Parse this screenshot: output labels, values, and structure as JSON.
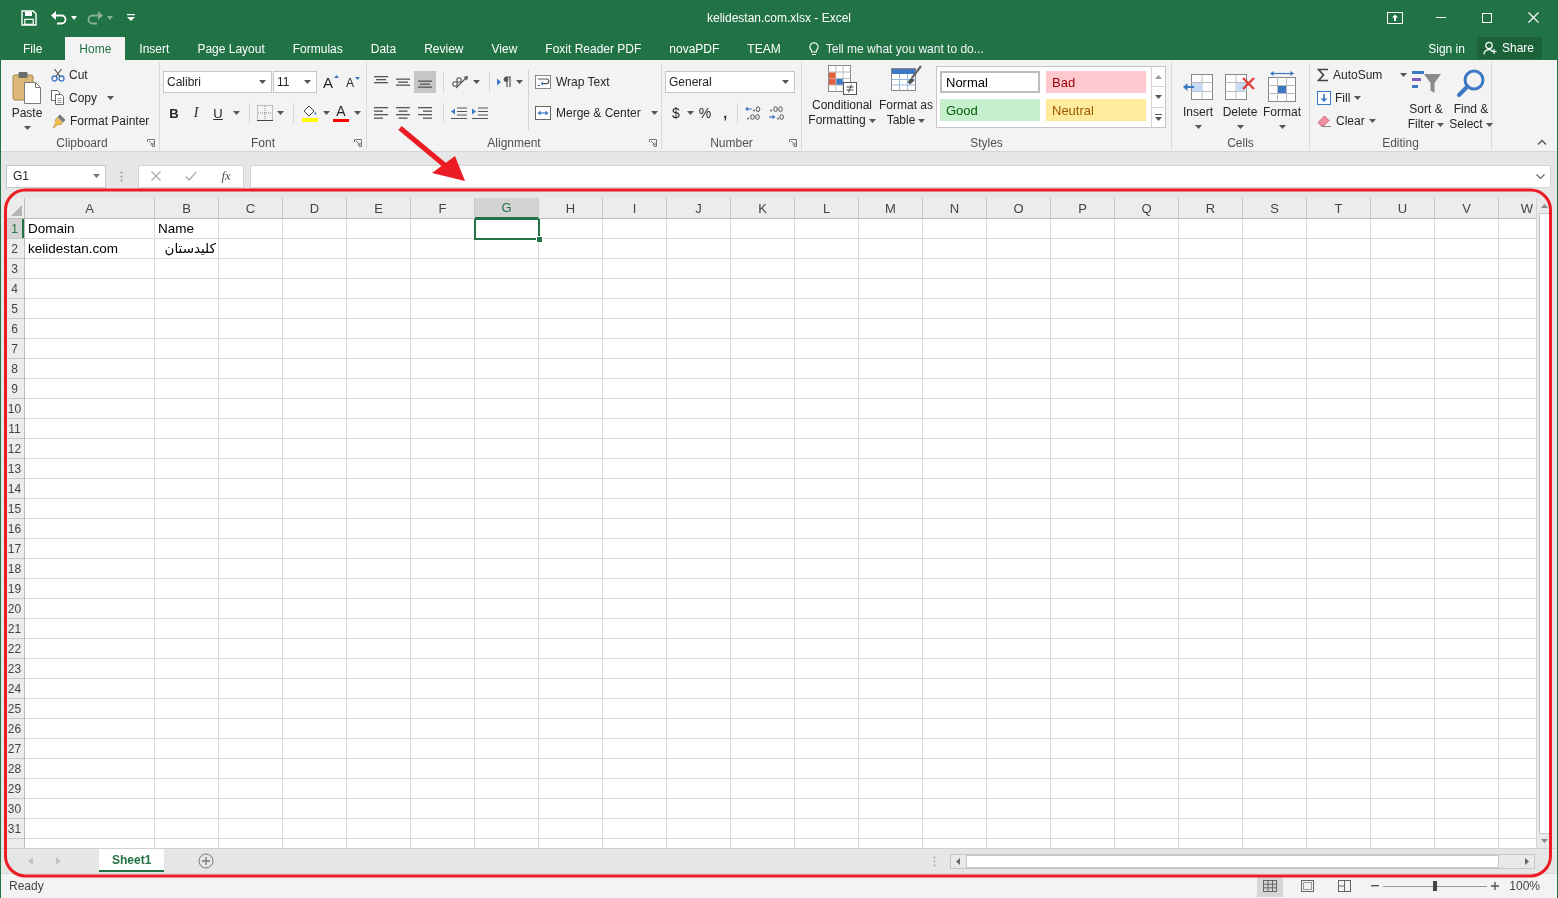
{
  "window": {
    "title": "kelidestan.com.xlsx - Excel"
  },
  "quick_access": [
    {
      "kind": "save",
      "disabled": false
    },
    {
      "kind": "undo",
      "disabled": false
    },
    {
      "kind": "redo",
      "disabled": true
    }
  ],
  "tabs": [
    {
      "label": "File",
      "selected": false
    },
    {
      "label": "Home",
      "selected": true
    },
    {
      "label": "Insert",
      "selected": false
    },
    {
      "label": "Page Layout",
      "selected": false
    },
    {
      "label": "Formulas",
      "selected": false
    },
    {
      "label": "Data",
      "selected": false
    },
    {
      "label": "Review",
      "selected": false
    },
    {
      "label": "View",
      "selected": false
    },
    {
      "label": "Foxit Reader PDF",
      "selected": false
    },
    {
      "label": "novaPDF",
      "selected": false
    },
    {
      "label": "TEAM",
      "selected": false
    }
  ],
  "tell_me": {
    "placeholder": "Tell me what you want to do..."
  },
  "account": {
    "sign_in": "Sign in",
    "share": "Share"
  },
  "ribbon": {
    "clipboard": {
      "label": "Clipboard",
      "paste": "Paste",
      "cut": "Cut",
      "copy": "Copy",
      "format_painter": "Format Painter"
    },
    "font": {
      "label": "Font",
      "font_name": "Calibri",
      "font_size": "11",
      "grow": "A",
      "shrink": "A",
      "bold": "B",
      "italic": "I",
      "underline": "U",
      "font_color": "A"
    },
    "alignment": {
      "label": "Alignment",
      "vertical_align": [
        {
          "kind": "top",
          "selected": false
        },
        {
          "kind": "middle",
          "selected": false
        },
        {
          "kind": "bottom",
          "selected": true
        }
      ],
      "horizontal_align": [
        {
          "kind": "left",
          "selected": false
        },
        {
          "kind": "center",
          "selected": false
        },
        {
          "kind": "right",
          "selected": false
        }
      ],
      "wrap_text": "Wrap Text",
      "merge_center": "Merge & Center"
    },
    "number": {
      "label": "Number",
      "format": "General",
      "currency": "$",
      "percent": "%",
      "comma": ","
    },
    "styles": {
      "label": "Styles",
      "conditional_formatting": "Conditional Formatting",
      "format_as_table": "Format as Table",
      "cell_styles": [
        {
          "label": "Normal",
          "kind": "normal",
          "selected": true
        },
        {
          "label": "Bad",
          "kind": "bad",
          "selected": false
        },
        {
          "label": "Good",
          "kind": "good",
          "selected": false
        },
        {
          "label": "Neutral",
          "kind": "neutral",
          "selected": false
        }
      ]
    },
    "cells": {
      "label": "Cells",
      "buttons": [
        {
          "label": "Insert",
          "kind": "insert"
        },
        {
          "label": "Delete",
          "kind": "delete"
        },
        {
          "label": "Format",
          "kind": "format"
        }
      ]
    },
    "editing": {
      "label": "Editing",
      "autosum": "AutoSum",
      "fill": "Fill",
      "clear": "Clear",
      "sort_filter": "Sort & Filter",
      "find_select": "Find & Select"
    }
  },
  "formula_bar": {
    "name_box": "G1",
    "function": "fx"
  },
  "sheet": {
    "columns": [
      {
        "label": "A",
        "selected": false
      },
      {
        "label": "B",
        "selected": false
      },
      {
        "label": "C",
        "selected": false
      },
      {
        "label": "D",
        "selected": false
      },
      {
        "label": "E",
        "selected": false
      },
      {
        "label": "F",
        "selected": false
      },
      {
        "label": "G",
        "selected": true
      },
      {
        "label": "H",
        "selected": false
      },
      {
        "label": "I",
        "selected": false
      },
      {
        "label": "J",
        "selected": false
      },
      {
        "label": "K",
        "selected": false
      },
      {
        "label": "L",
        "selected": false
      },
      {
        "label": "M",
        "selected": false
      },
      {
        "label": "N",
        "selected": false
      },
      {
        "label": "O",
        "selected": false
      },
      {
        "label": "P",
        "selected": false
      },
      {
        "label": "Q",
        "selected": false
      },
      {
        "label": "R",
        "selected": false
      },
      {
        "label": "S",
        "selected": false
      },
      {
        "label": "T",
        "selected": false
      },
      {
        "label": "U",
        "selected": false
      },
      {
        "label": "V",
        "selected": false
      },
      {
        "label": "W",
        "selected": false
      }
    ],
    "rows": [
      {
        "label": "1",
        "selected": true,
        "cells": [
          "Domain",
          "Name"
        ]
      },
      {
        "label": "2",
        "selected": false,
        "cells": [
          "kelidestan.com",
          "کلیدستان"
        ]
      },
      {
        "label": "3",
        "selected": false
      },
      {
        "label": "4",
        "selected": false
      },
      {
        "label": "5",
        "selected": false
      },
      {
        "label": "6",
        "selected": false
      },
      {
        "label": "7",
        "selected": false
      },
      {
        "label": "8",
        "selected": false
      },
      {
        "label": "9",
        "selected": false
      },
      {
        "label": "10",
        "selected": false
      },
      {
        "label": "11",
        "selected": false
      },
      {
        "label": "12",
        "selected": false
      },
      {
        "label": "13",
        "selected": false
      },
      {
        "label": "14",
        "selected": false
      },
      {
        "label": "15",
        "selected": false
      },
      {
        "label": "16",
        "selected": false
      },
      {
        "label": "17",
        "selected": false
      },
      {
        "label": "18",
        "selected": false
      },
      {
        "label": "19",
        "selected": false
      },
      {
        "label": "20",
        "selected": false
      },
      {
        "label": "21",
        "selected": false
      },
      {
        "label": "22",
        "selected": false
      },
      {
        "label": "23",
        "selected": false
      },
      {
        "label": "24",
        "selected": false
      },
      {
        "label": "25",
        "selected": false
      },
      {
        "label": "26",
        "selected": false
      },
      {
        "label": "27",
        "selected": false
      },
      {
        "label": "28",
        "selected": false
      },
      {
        "label": "29",
        "selected": false
      },
      {
        "label": "30",
        "selected": false
      },
      {
        "label": "31",
        "selected": false
      }
    ]
  },
  "sheet_tabs": [
    {
      "label": "Sheet1",
      "selected": true
    }
  ],
  "status_bar": {
    "status": "Ready",
    "views": [
      {
        "kind": "normal",
        "selected": true
      },
      {
        "kind": "page_layout",
        "selected": false
      },
      {
        "kind": "page_break",
        "selected": false
      }
    ],
    "zoom": {
      "level": 0.5,
      "reading": "100%"
    }
  }
}
